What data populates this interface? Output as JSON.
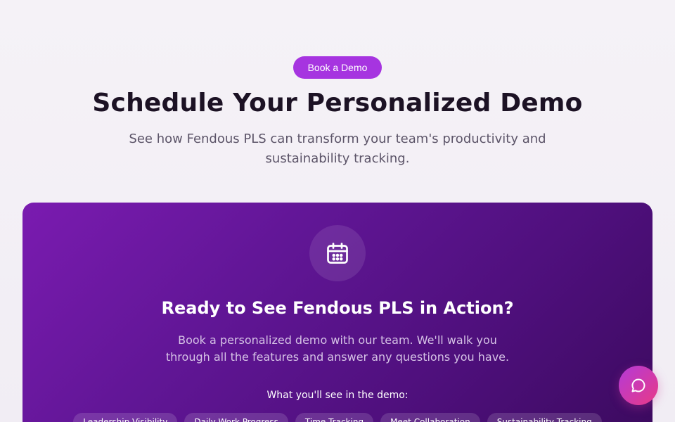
{
  "hero": {
    "badge_label": "Book a Demo",
    "title": "Schedule Your Personalized Demo",
    "subtitle": "See how Fendous PLS can transform your team's productivity and sustainability tracking."
  },
  "card": {
    "icon": "calendar-icon",
    "title": "Ready to See Fendous PLS in Action?",
    "subtitle": "Book a personalized demo with our team. We'll walk you through all the features and answer any questions you have.",
    "features_label": "What you'll see in the demo:",
    "features": [
      "Leadership Visibility",
      "Daily Work Progress",
      "Time Tracking",
      "Meet Collaboration",
      "Sustainability Tracking"
    ]
  },
  "chat": {
    "icon": "chat-bubble-icon"
  },
  "colors": {
    "accent": "#a634e0",
    "card_gradient_start": "#7a1bb0",
    "card_gradient_end": "#3b0a5e",
    "chat_gradient_start": "#b43ad8",
    "chat_gradient_end": "#e83a86"
  }
}
